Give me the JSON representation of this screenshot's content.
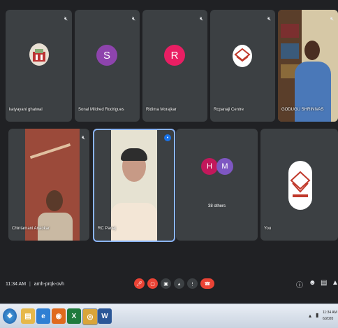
{
  "tiles": [
    {
      "name": "katyayani ghatwal"
    },
    {
      "name": "Sonal Mildred Rodrigues",
      "initial": "S"
    },
    {
      "name": "Ridima Morajkar",
      "initial": "R"
    },
    {
      "name": "Rcpanaji Centre"
    },
    {
      "name": "GODUGU SHRINIVAS"
    },
    {
      "name": "Chintamani Anaokar"
    },
    {
      "name": "RC Panaj"
    },
    {
      "name": "38 others",
      "initials": [
        "H",
        "M"
      ]
    },
    {
      "name": "You"
    }
  ],
  "meeting": {
    "time": "11:34 AM",
    "separator": "|",
    "code": "amh-prqk-ovh"
  },
  "controls": [
    "mic-off-icon",
    "camera-off-icon",
    "captions-icon",
    "present-icon",
    "more-icon",
    "end-call-icon"
  ],
  "taskbar": {
    "clock_time": "11:34 AM",
    "clock_date": "6/2020",
    "icons": [
      "windows-start",
      "file-explorer",
      "internet-explorer",
      "firefox",
      "excel",
      "chrome",
      "word"
    ]
  },
  "colors": {
    "meet_bg": "#202124",
    "tile_bg": "#3c4043",
    "sonal_avatar": "#8e44ad",
    "ridima_avatar": "#e91e63",
    "end_call": "#ea4335"
  }
}
